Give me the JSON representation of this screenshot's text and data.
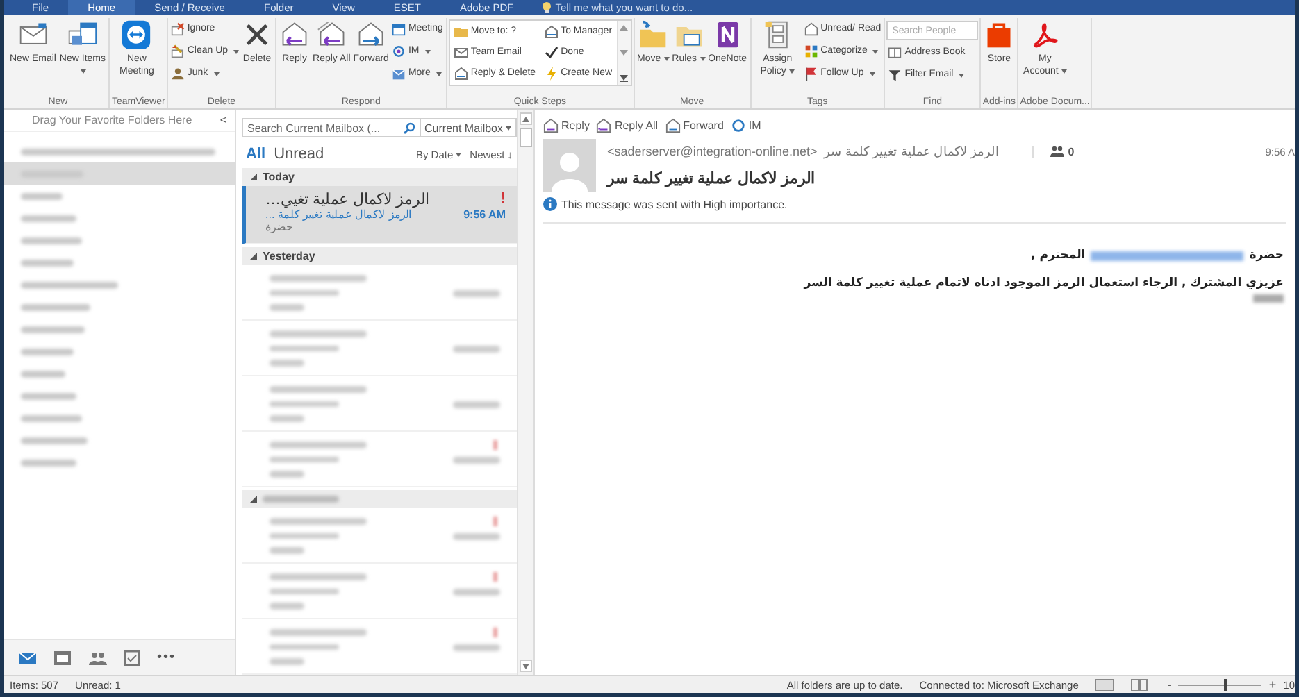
{
  "tabs": [
    {
      "label": "File",
      "selected": false
    },
    {
      "label": "Home",
      "selected": true
    },
    {
      "label": "Send / Receive",
      "selected": false
    },
    {
      "label": "Folder",
      "selected": false
    },
    {
      "label": "View",
      "selected": false
    },
    {
      "label": "ESET",
      "selected": false
    },
    {
      "label": "Adobe PDF",
      "selected": false
    }
  ],
  "tell_me": {
    "placeholder": "Tell me what you want to do..."
  },
  "ribbon": {
    "groups": [
      {
        "label": "New",
        "kind": "buttons",
        "items": [
          {
            "kind": "large",
            "label": "New Email",
            "dropdown": false
          },
          {
            "kind": "large",
            "label": "New Items",
            "dropdown": true
          }
        ]
      },
      {
        "label": "TeamViewer",
        "kind": "buttons",
        "items": [
          {
            "kind": "large",
            "label": "New Meeting",
            "dropdown": false
          }
        ]
      },
      {
        "label": "Delete",
        "kind": "buttons",
        "items": [
          {
            "kind": "small",
            "label": "Ignore",
            "dropdown": false
          },
          {
            "kind": "small",
            "label": "Clean Up",
            "dropdown": true
          },
          {
            "kind": "small",
            "label": "Junk",
            "dropdown": true
          },
          {
            "kind": "large",
            "label": "Delete",
            "dropdown": false
          }
        ]
      },
      {
        "label": "Respond",
        "kind": "buttons",
        "items": [
          {
            "kind": "large",
            "label": "Reply",
            "dropdown": false
          },
          {
            "kind": "large",
            "label": "Reply All",
            "dropdown": false
          },
          {
            "kind": "large",
            "label": "Forward",
            "dropdown": false
          },
          {
            "kind": "small",
            "label": "Meeting",
            "dropdown": false
          },
          {
            "kind": "small",
            "label": "IM",
            "dropdown": true
          },
          {
            "kind": "small",
            "label": "More",
            "dropdown": true
          }
        ]
      },
      {
        "label": "Quick Steps",
        "kind": "quicksteps",
        "items": [
          {
            "kind": "small",
            "label": "Move to: ?",
            "dropdown": false
          },
          {
            "kind": "small",
            "label": "Team Email",
            "dropdown": false
          },
          {
            "kind": "small",
            "label": "Reply & Delete",
            "dropdown": false
          },
          {
            "kind": "small",
            "label": "To Manager",
            "dropdown": false
          },
          {
            "kind": "small",
            "label": "Done",
            "dropdown": false
          },
          {
            "kind": "small",
            "label": "Create New",
            "dropdown": false
          }
        ]
      },
      {
        "label": "Move",
        "kind": "buttons",
        "items": [
          {
            "kind": "large",
            "label": "Move",
            "dropdown": true
          },
          {
            "kind": "large",
            "label": "Rules",
            "dropdown": true
          },
          {
            "kind": "large",
            "label": "OneNote",
            "dropdown": false
          }
        ]
      },
      {
        "label": "Tags",
        "kind": "buttons",
        "items": [
          {
            "kind": "large",
            "label": "Assign Policy",
            "dropdown": true
          },
          {
            "kind": "small",
            "label": "Unread/ Read",
            "dropdown": false
          },
          {
            "kind": "small",
            "label": "Categorize",
            "dropdown": true
          },
          {
            "kind": "small",
            "label": "Follow Up",
            "dropdown": true
          }
        ]
      },
      {
        "label": "Find",
        "kind": "find",
        "placeholder": "Search People",
        "items": [
          {
            "kind": "small",
            "label": "Address Book",
            "dropdown": false
          },
          {
            "kind": "small",
            "label": "Filter Email",
            "dropdown": true
          }
        ]
      },
      {
        "label": "Add-ins",
        "kind": "buttons",
        "items": [
          {
            "kind": "large",
            "label": "Store",
            "dropdown": false
          }
        ]
      },
      {
        "label": "Adobe Docum...",
        "kind": "buttons",
        "items": [
          {
            "kind": "large",
            "label": "My Account",
            "dropdown": true
          }
        ]
      }
    ]
  },
  "folder_pane": {
    "favorites_hint": "Drag Your Favorite Folders Here",
    "collapse": "<",
    "folders": [
      {
        "selected": false
      },
      {
        "selected": true
      },
      {
        "selected": false
      },
      {
        "selected": false
      },
      {
        "selected": false
      },
      {
        "selected": false
      },
      {
        "selected": false
      },
      {
        "selected": false
      },
      {
        "selected": false
      },
      {
        "selected": false
      },
      {
        "selected": false
      },
      {
        "selected": false
      },
      {
        "selected": false
      },
      {
        "selected": false
      },
      {
        "selected": false
      }
    ],
    "nav": [
      {
        "selected": true
      },
      {
        "selected": false
      },
      {
        "selected": false
      },
      {
        "selected": false
      }
    ],
    "nav_more": "•••"
  },
  "message_list": {
    "search": {
      "placeholder": "Search Current Mailbox (...",
      "scope": "Current Mailbox"
    },
    "filters": [
      {
        "label": "All",
        "selected": true
      },
      {
        "label": "Unread",
        "selected": false
      }
    ],
    "sort": "By Date",
    "order": "Newest ↓",
    "groups": [
      {
        "kind": "named",
        "label": "Today",
        "items": [
          {
            "kind": "message",
            "sender": "الرمز لاكمال عملية تغيي…",
            "subject": "الرمز لاكمال عملية تغيير كلمة ...",
            "preview": "حضرة",
            "time": "9:56 AM",
            "importance": "!",
            "selected": true
          }
        ]
      },
      {
        "kind": "named",
        "label": "Yesterday",
        "items": [
          {
            "kind": "redacted",
            "important": false
          },
          {
            "kind": "redacted",
            "important": false
          },
          {
            "kind": "redacted",
            "important": false
          },
          {
            "kind": "redacted",
            "important": true
          }
        ]
      },
      {
        "kind": "redacted",
        "items": [
          {
            "kind": "redacted",
            "important": true
          },
          {
            "kind": "redacted",
            "important": true
          },
          {
            "kind": "redacted",
            "important": true
          }
        ]
      }
    ]
  },
  "reading_pane": {
    "actions": [
      "Reply",
      "Reply All",
      "Forward",
      "IM"
    ],
    "sender_email": "<saderserver@integration-online.net>",
    "sender_name": "الرمز لاكمال عملية تغيير كلمة سر",
    "people_count": "0",
    "time": "9:56 A",
    "subject": "الرمز لاكمال عملية تغيير كلمة سر",
    "importance_note": "This message was sent with High importance.",
    "greeting_prefix": "حضرة",
    "greeting_suffix": "المحترم ,",
    "body": "عزيزي المشترك , الرجاء استعمال الرمز الموجود ادناه لاتمام عملية تغيير كلمة السر"
  },
  "status_bar": {
    "items": "Items: 507",
    "unread": "Unread: 1",
    "sync": "All folders are up to date.",
    "connection": "Connected to: Microsoft Exchange",
    "zoom": {
      "minus": "-",
      "plus": "+",
      "level": 0.55,
      "percent": "10"
    }
  }
}
